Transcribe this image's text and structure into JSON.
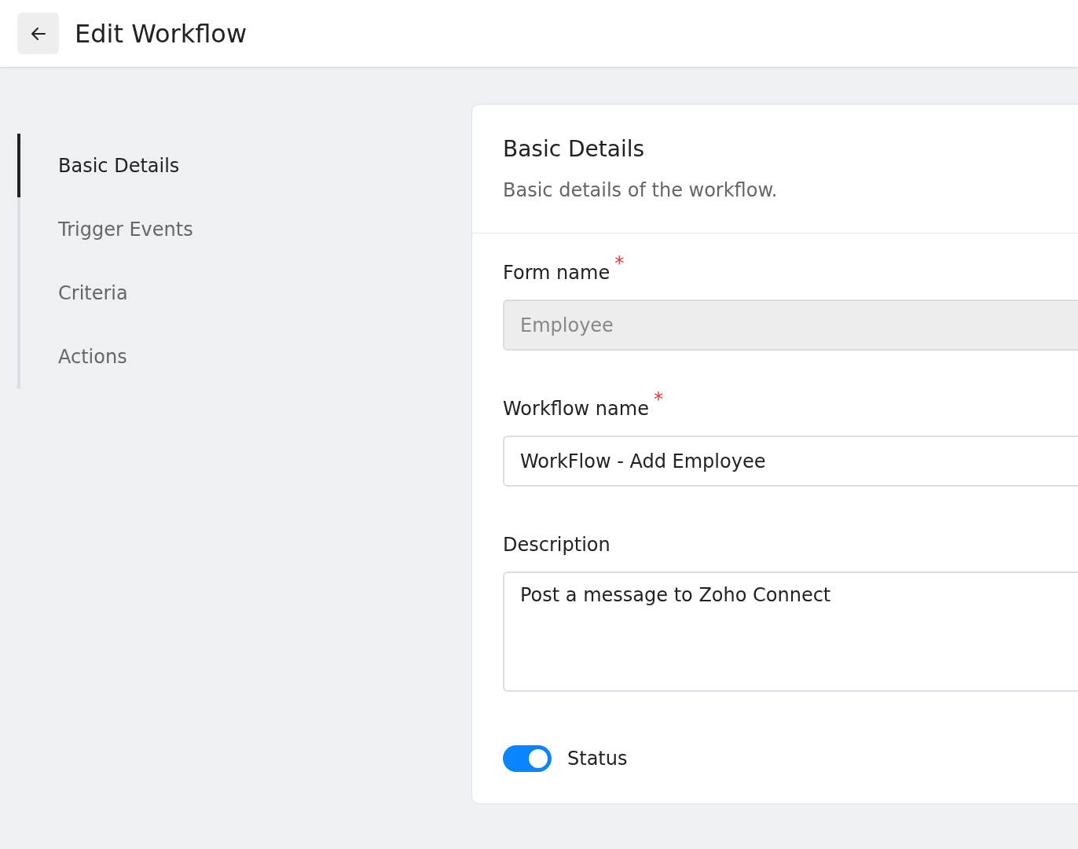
{
  "header": {
    "title": "Edit Workflow"
  },
  "nav": [
    {
      "label": "Basic Details",
      "selected": true
    },
    {
      "label": "Trigger Events",
      "selected": false
    },
    {
      "label": "Criteria",
      "selected": false
    },
    {
      "label": "Actions",
      "selected": false
    }
  ],
  "card": {
    "title": "Basic Details",
    "subtitle": "Basic details of the workflow.",
    "fields": [
      {
        "kind": "input",
        "label": "Form name",
        "required_mark": "*",
        "value": "Employee",
        "disabled": true
      },
      {
        "kind": "input",
        "label": "Workflow name",
        "required_mark": "*",
        "value": "WorkFlow - Add Employee",
        "disabled": false
      },
      {
        "kind": "textarea",
        "label": "Description",
        "value": "Post a message to Zoho Connect",
        "disabled": false
      }
    ],
    "status": {
      "label": "Status",
      "on": true
    }
  }
}
